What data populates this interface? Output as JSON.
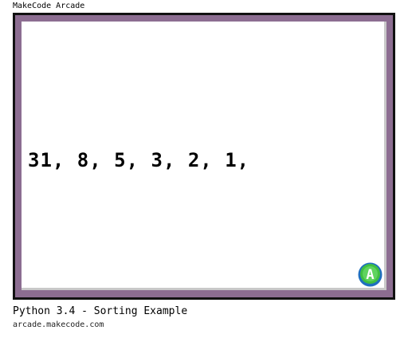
{
  "app": {
    "title": "MakeCode Arcade"
  },
  "screen": {
    "output_text": "31, 8, 5, 3, 2, 1,",
    "a_button_label": "A"
  },
  "caption": {
    "title": "Python 3.4 - Sorting Example",
    "site": "arcade.makecode.com"
  },
  "colors": {
    "frame_border": "#8c6d91",
    "frame_dark": "#111111",
    "screen_bg": "#ffffff",
    "button_green": "#3fbf3f",
    "button_blue": "#1f6fbf"
  }
}
